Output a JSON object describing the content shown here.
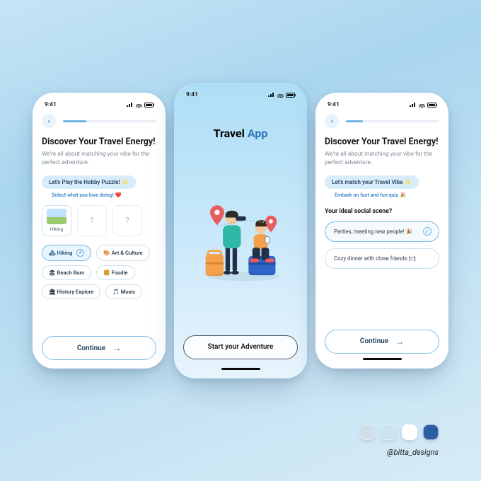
{
  "status": {
    "time": "9:41"
  },
  "screen1": {
    "title": "Discover Your Travel Energy!",
    "subtitle": "We're all about matching your vibe for the perfect adventure.",
    "pill": "Let's Play the Hobby Puzzle! ✨",
    "hint": "Select what you love doing! ❤️",
    "slot_filled_label": "Hiking",
    "slot_placeholder": "?",
    "chips": {
      "hiking": "🏔 Hiking",
      "art": "🎨 Art & Culture",
      "beach": "🏖 Beach Bum",
      "foodie": "🍔 Foodie",
      "history": "🏛 History Explore",
      "music": "🎵 Music"
    },
    "continue": "Continue",
    "progress_pct": 25
  },
  "screen2": {
    "brand_a": "Travel ",
    "brand_b": "App",
    "cta": "Start your Adventure"
  },
  "screen3": {
    "title": "Discover Your Travel Energy!",
    "subtitle": "We're all about matching your vibe for the perfect adventure.",
    "pill": "Let's match your Travel Vibe ✨",
    "hint": "Embark on fast and fun quiz 🎉",
    "question": "Your ideal social scene?",
    "opt1": "Parties, meeting new people! 🎉",
    "opt2": "Cozy dinner with close friends 🍽",
    "continue": "Continue",
    "progress_pct": 18
  },
  "palette": {
    "c1": "#cfdfe9",
    "c2": "#c9e3f2",
    "c3": "#ffffff",
    "c4": "#2c5da3"
  },
  "handle": "@bitta_designs"
}
